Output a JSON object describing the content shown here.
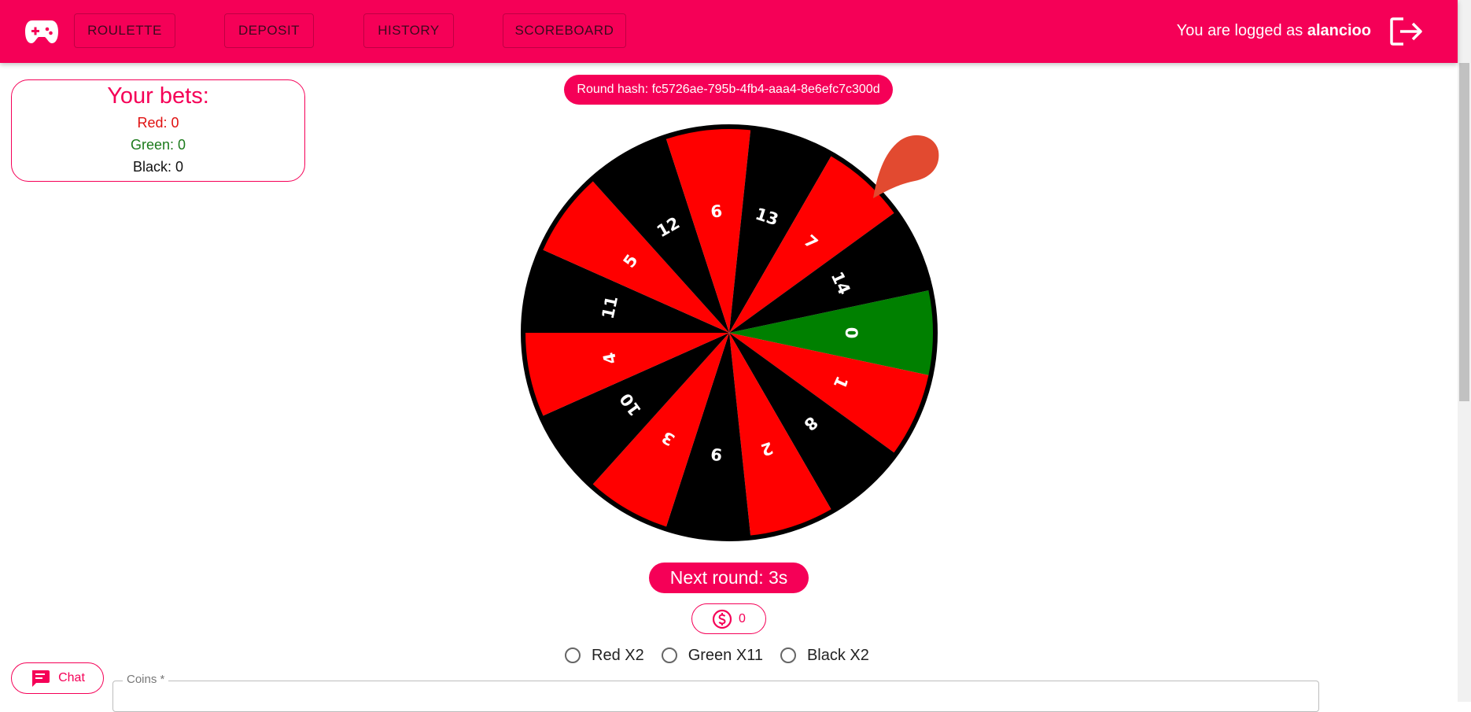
{
  "header": {
    "nav": [
      {
        "label": "ROULETTE"
      },
      {
        "label": "DEPOSIT"
      },
      {
        "label": "HISTORY"
      },
      {
        "label": "SCOREBOARD"
      }
    ],
    "login_prefix": "You are logged as",
    "username": "alancioo",
    "icons": {
      "logo": "gamepad-icon",
      "logout": "logout-icon"
    },
    "color": "#f50057"
  },
  "bets": {
    "title": "Your bets:",
    "red": "Red: 0",
    "green": "Green: 0",
    "black": "Black: 0"
  },
  "round": {
    "hash_label": "Round hash: fc5726ae-795b-4fb4-aaa4-8e6efc7c300d",
    "next_round": "Next round: 3s"
  },
  "wheel": {
    "rotation_deg": 12,
    "slots": [
      {
        "label": "0",
        "color": "green"
      },
      {
        "label": "1",
        "color": "red"
      },
      {
        "label": "8",
        "color": "black"
      },
      {
        "label": "2",
        "color": "red"
      },
      {
        "label": "9",
        "color": "black"
      },
      {
        "label": "3",
        "color": "red"
      },
      {
        "label": "10",
        "color": "black"
      },
      {
        "label": "4",
        "color": "red"
      },
      {
        "label": "11",
        "color": "black"
      },
      {
        "label": "5",
        "color": "red"
      },
      {
        "label": "12",
        "color": "black"
      },
      {
        "label": "6",
        "color": "red"
      },
      {
        "label": "13",
        "color": "black"
      },
      {
        "label": "7",
        "color": "red"
      },
      {
        "label": "14",
        "color": "black"
      }
    ],
    "colors": {
      "red": "#ff0000",
      "black": "#000000",
      "green": "#008000"
    },
    "pointer_color": "#e24a30"
  },
  "balance": {
    "value": "0",
    "icon": "dollar-circle-icon"
  },
  "options": [
    {
      "label": "Red X2"
    },
    {
      "label": "Green X11"
    },
    {
      "label": "Black X2"
    }
  ],
  "chat": {
    "label": "Chat",
    "icon": "chat-icon"
  },
  "coins_field": {
    "label": "Coins *"
  }
}
